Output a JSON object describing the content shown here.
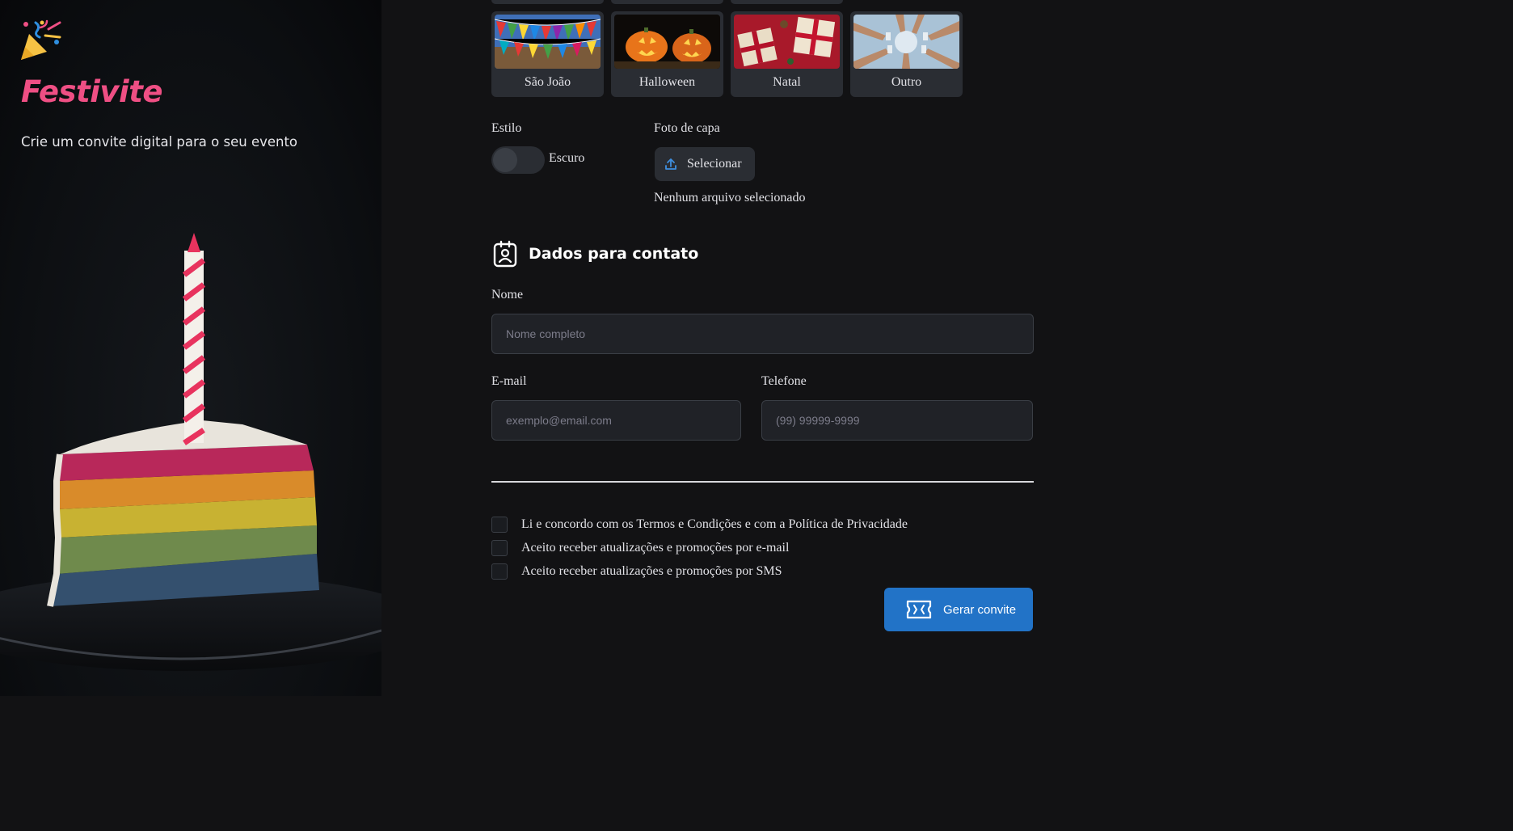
{
  "brand": {
    "name": "Festivite",
    "tagline": "Crie um convite digital para o seu evento"
  },
  "themes": [
    {
      "label": "São João",
      "thumb": "festa-junina-flags"
    },
    {
      "label": "Halloween",
      "thumb": "jack-o-lanterns"
    },
    {
      "label": "Natal",
      "thumb": "gift-boxes"
    },
    {
      "label": "Outro",
      "thumb": "toasting-hands"
    }
  ],
  "style": {
    "label": "Estilo",
    "toggle_text": "Escuro",
    "dark_mode": false
  },
  "cover": {
    "label": "Foto de capa",
    "button": "Selecionar",
    "status": "Nenhum arquivo selecionado"
  },
  "contact": {
    "title": "Dados para contato",
    "name_label": "Nome",
    "name_placeholder": "Nome completo",
    "email_label": "E-mail",
    "email_placeholder": "exemplo@email.com",
    "phone_label": "Telefone",
    "phone_placeholder": "(99) 99999-9999"
  },
  "consents": [
    {
      "text": "Li e concordo com os Termos e Condições e com a Política de Privacidade",
      "checked": false
    },
    {
      "text": "Aceito receber atualizações e promoções por e-mail",
      "checked": false
    },
    {
      "text": "Aceito receber atualizações e promoções por SMS",
      "checked": false
    }
  ],
  "submit_label": "Gerar convite",
  "colors": {
    "accent": "#2273c7",
    "brand": "#ef4f84",
    "background": "#121214",
    "surface": "#2a2d33"
  }
}
